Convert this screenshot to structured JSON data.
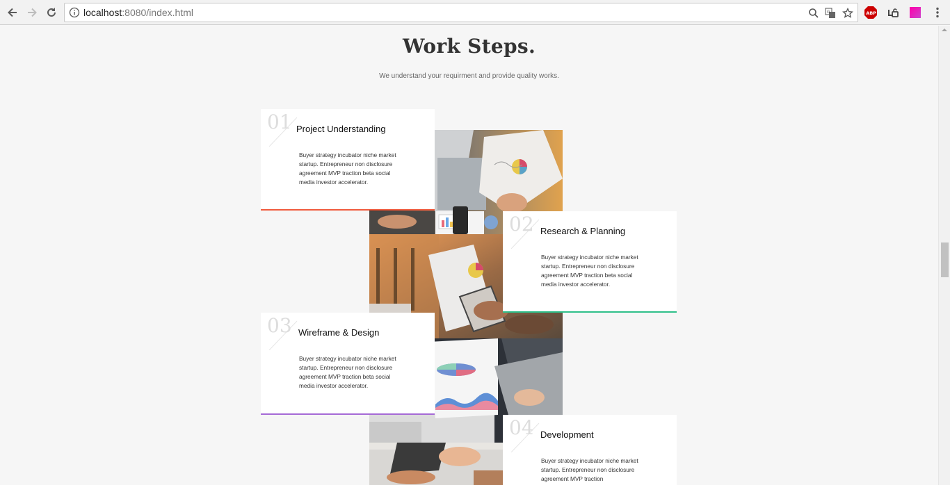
{
  "browser": {
    "url_host": "localhost",
    "url_rest": ":8080/index.html",
    "extensions": [
      "abp-icon",
      "vk-icon",
      "color-picker-icon"
    ]
  },
  "section": {
    "title": "Work Steps.",
    "subtitle": "We understand your requirment and provide quality works."
  },
  "steps": [
    {
      "number": "01",
      "title": "Project Understanding",
      "description": "Buyer strategy incubator niche market startup. Entrepreneur non disclosure agreement MVP traction beta social media investor accelerator.",
      "accent": "#f05a3c"
    },
    {
      "number": "02",
      "title": "Research & Planning",
      "description": "Buyer strategy incubator niche market startup. Entrepreneur non disclosure agreement MVP traction beta social media investor accelerator.",
      "accent": "#2fbf8a"
    },
    {
      "number": "03",
      "title": "Wireframe & Design",
      "description": "Buyer strategy incubator niche market startup. Entrepreneur non disclosure agreement MVP traction beta social media investor accelerator.",
      "accent": "#a56ad6"
    },
    {
      "number": "04",
      "title": "Development",
      "description": "Buyer strategy incubator niche market startup. Entrepreneur non disclosure agreement MVP traction",
      "accent": "#3a8ee6"
    }
  ]
}
